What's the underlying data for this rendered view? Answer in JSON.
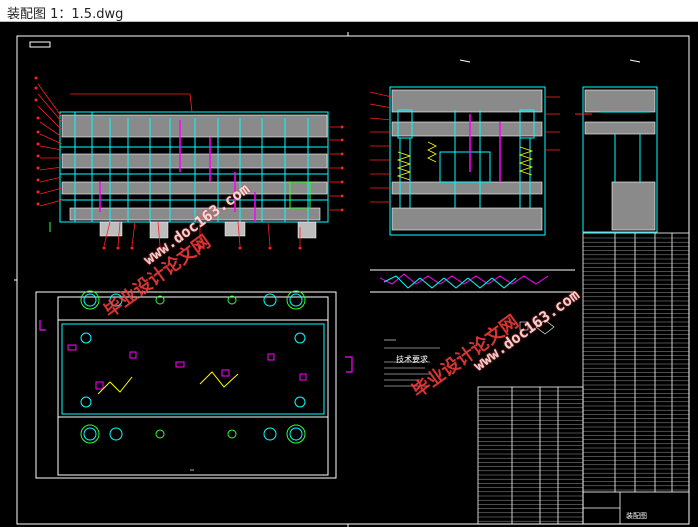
{
  "window": {
    "title": "装配图 1：1.5.dwg"
  },
  "drawing": {
    "technical_requirements_title": "技术要求",
    "title_block_label": "装配图",
    "watermarks": [
      {
        "text": "毕业设计论文网",
        "url": "www.doc163.com"
      },
      {
        "text": "毕业设计论文网",
        "url": "www.doc163.com"
      }
    ]
  },
  "colors": {
    "background": "#000000",
    "line_white": "#ffffff",
    "line_cyan": "#00ffff",
    "line_magenta": "#ff00ff",
    "line_red": "#ff2020",
    "line_green": "#33ff33",
    "line_yellow": "#ffff00",
    "hatch": "#bdbdbd"
  }
}
